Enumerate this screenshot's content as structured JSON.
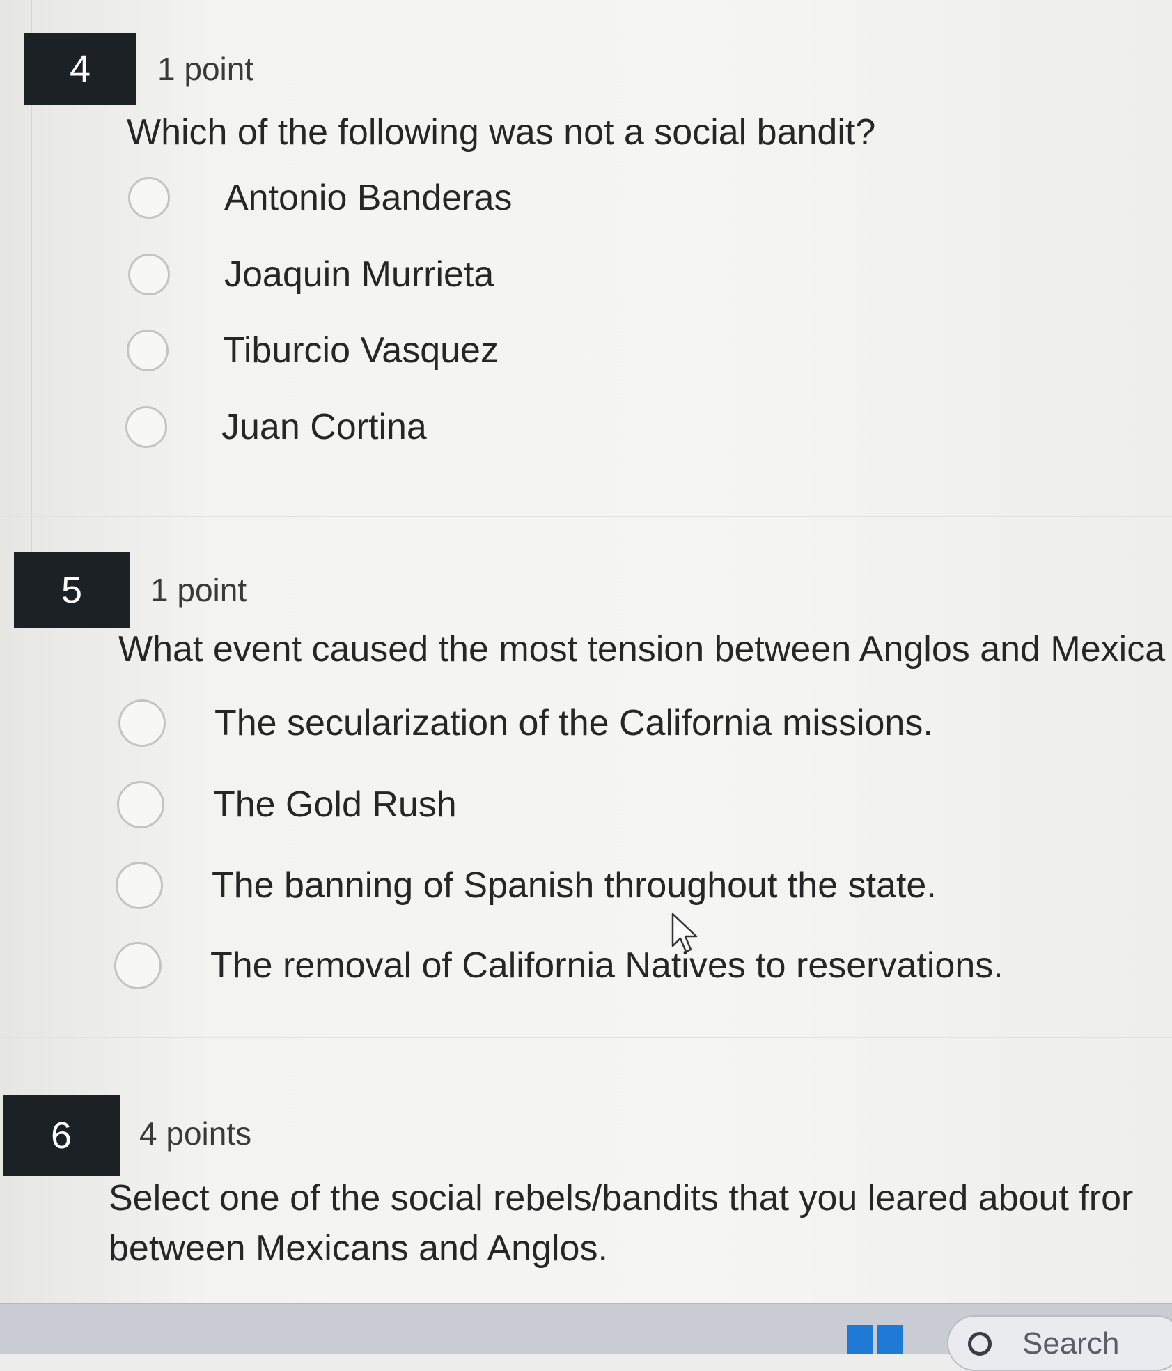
{
  "questions": [
    {
      "number": "4",
      "points": "1 point",
      "text": "Which of the following was not a social bandit?",
      "options": [
        "Antonio Banderas",
        "Joaquin Murrieta",
        "Tiburcio Vasquez",
        "Juan Cortina"
      ]
    },
    {
      "number": "5",
      "points": "1 point",
      "text": "What event caused the most tension between Anglos and Mexica",
      "options": [
        "The secularization of the California missions.",
        "The Gold Rush",
        "The banning of Spanish throughout the state.",
        "The removal of California Natives to reservations."
      ]
    },
    {
      "number": "6",
      "points": "4 points",
      "text_line1": "Select one of the social rebels/bandits that you leared about fror",
      "text_line2": "between Mexicans and Anglos."
    }
  ],
  "taskbar": {
    "search_label": "Search",
    "icons": [
      "windows-start-icon",
      "search-icon"
    ]
  },
  "colors": {
    "number_badge": "#1c2126",
    "background": "#f3f3f1",
    "radio_border": "#c4c4c1",
    "windows_blue": "#1f7ad6"
  }
}
